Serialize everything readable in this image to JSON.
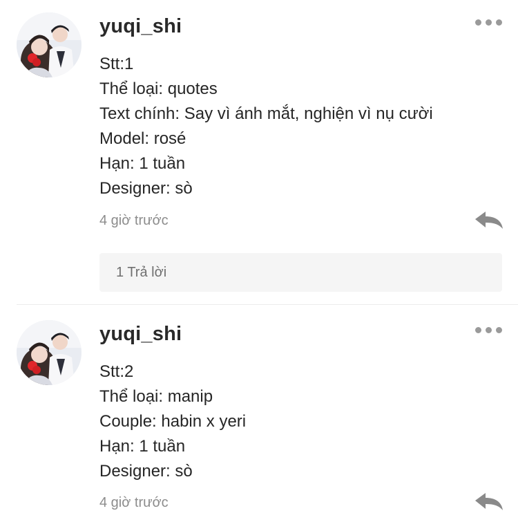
{
  "comments": [
    {
      "username": "yuqi_shi",
      "lines": [
        "Stt:1",
        "Thể loại: quotes",
        "Text chính: Say vì ánh mắt, nghiện vì nụ cười",
        "Model: rosé",
        "Hạn: 1 tuần",
        "Designer: sò"
      ],
      "time": "4 giờ trước",
      "replies_label": "1 Trả lời"
    },
    {
      "username": "yuqi_shi",
      "lines": [
        "Stt:2",
        "Thể loại: manip",
        "Couple: habin x yeri",
        "Hạn: 1 tuần",
        "Designer: sò"
      ],
      "time": "4 giờ trước"
    }
  ],
  "icons": {
    "more": "more-dots-icon",
    "reply": "reply-arrow-icon"
  },
  "colors": {
    "username": "#2a2a2a",
    "body_text": "#262626",
    "timestamp": "#8c8c8c",
    "icon_gray": "#8a8a8a",
    "reply_box_bg": "#f5f5f5"
  }
}
